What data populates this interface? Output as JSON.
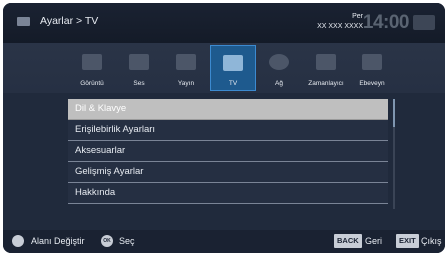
{
  "header": {
    "breadcrumb": "Ayarlar > TV",
    "day": "Per",
    "date": "XX XXX XXXX",
    "time": "14:00"
  },
  "categories": [
    {
      "label": "Görüntü",
      "icon": "picture-icon"
    },
    {
      "label": "Ses",
      "icon": "sound-icon"
    },
    {
      "label": "Yayın",
      "icon": "antenna-icon"
    },
    {
      "label": "TV",
      "icon": "tv-icon"
    },
    {
      "label": "Ağ",
      "icon": "globe-icon"
    },
    {
      "label": "Zamanlayıcı",
      "icon": "calendar-icon"
    },
    {
      "label": "Ebeveyn",
      "icon": "parental-icon"
    }
  ],
  "selected_category": "TV",
  "menu_items": [
    {
      "label": "Dil & Klavye"
    },
    {
      "label": "Erişilebirlik Ayarları"
    },
    {
      "label": "Aksesuarlar"
    },
    {
      "label": "Gelişmiş Ayarlar"
    },
    {
      "label": "Hakkında"
    }
  ],
  "selected_item": "Dil & Klavye",
  "footer": {
    "nav_label": "Alanı Değiştir",
    "ok_key": "OK",
    "ok_label": "Seç",
    "back_key": "BACK",
    "back_label": "Geri",
    "exit_key": "EXIT",
    "exit_label": "Çıkış"
  },
  "colors": {
    "background": "#202a3c",
    "selected_category": "#1e5a8e",
    "selected_row": "#bfbfbf"
  }
}
